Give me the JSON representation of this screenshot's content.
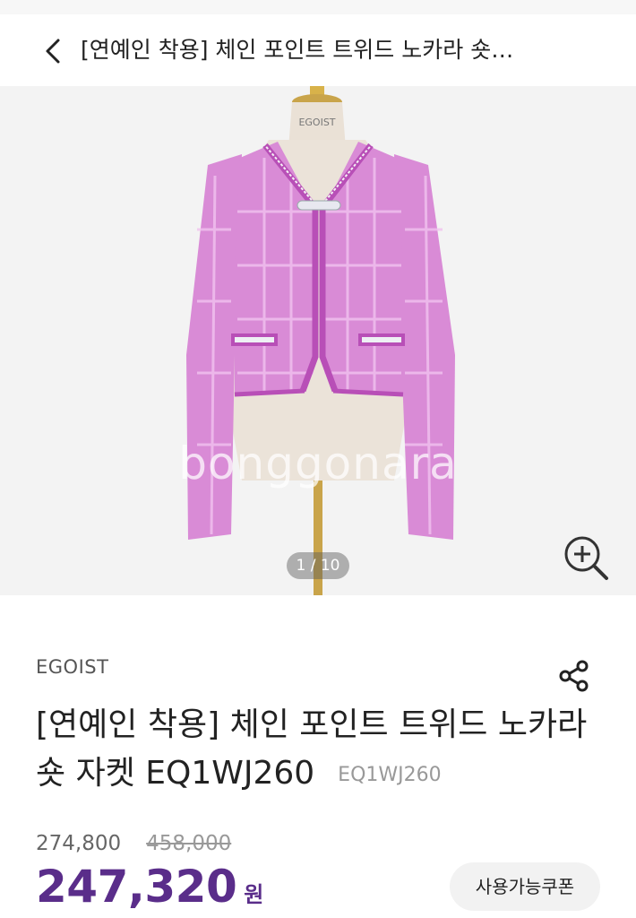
{
  "header": {
    "title": "[연예인 착용] 체인 포인트 트위드 노카라 숏…"
  },
  "gallery": {
    "mannequin_label": "EGOIST",
    "watermark": "bonggonara",
    "counter": "1 / 10"
  },
  "product": {
    "brand": "EGOIST",
    "name": "[연예인 착용] 체인 포인트 트위드 노카라 숏 자켓 EQ1WJ260",
    "code": "EQ1WJ260"
  },
  "price": {
    "reference": "274,800",
    "original": "458,000",
    "sale": "247,320",
    "currency": "원"
  },
  "coupon_label": "사용가능쿠폰",
  "colors": {
    "accent": "#5a2d8a",
    "jacket": "#d98bd6",
    "background": "#f3f3f3"
  }
}
